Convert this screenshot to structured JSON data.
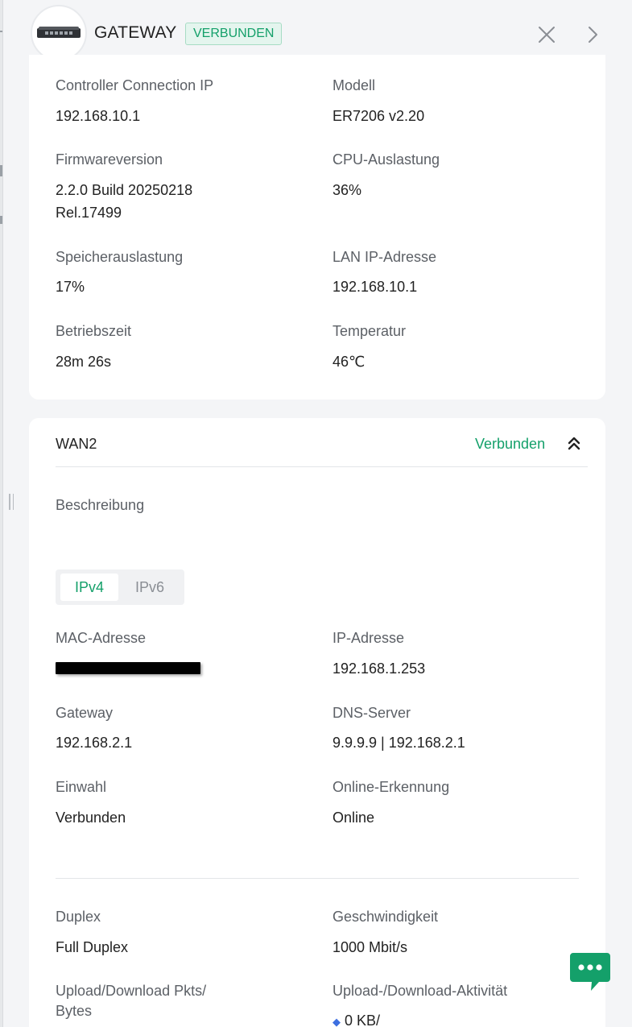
{
  "header": {
    "title": "GATEWAY",
    "status": "VERBUNDEN",
    "device_icon": "router-device-image",
    "close_icon": "close-icon",
    "next_icon": "chevron-right-icon"
  },
  "overview": {
    "fields": [
      {
        "label": "Controller Connection IP",
        "value": "192.168.10.1"
      },
      {
        "label": "Modell",
        "value": "ER7206 v2.20"
      },
      {
        "label": "Firmwareversion",
        "value": "2.2.0 Build 20250218",
        "value2": "Rel.17499"
      },
      {
        "label": "CPU-Auslastung",
        "value": "36%"
      },
      {
        "label": "Speicherauslastung",
        "value": "17%"
      },
      {
        "label": "LAN IP-Adresse",
        "value": "192.168.10.1"
      },
      {
        "label": "Betriebszeit",
        "value": "28m 26s"
      },
      {
        "label": "Temperatur",
        "value": "46℃"
      }
    ]
  },
  "wan": {
    "title": "WAN2",
    "status": "Verbunden",
    "description_label": "Beschreibung",
    "tabs": [
      {
        "label": "IPv4",
        "active": true
      },
      {
        "label": "IPv6",
        "active": false
      }
    ],
    "fields": [
      {
        "label": "MAC-Adresse",
        "value": ""
      },
      {
        "label": "IP-Adresse",
        "value": "192.168.1.253"
      },
      {
        "label": "Gateway",
        "value": "192.168.2.1"
      },
      {
        "label": "DNS-Server",
        "value": "9.9.9.9 | 192.168.2.1"
      },
      {
        "label": "Einwahl",
        "value": "Verbunden"
      },
      {
        "label": "Online-Erkennung",
        "value": "Online"
      },
      {
        "label": "Duplex",
        "value": "Full Duplex"
      },
      {
        "label": "Geschwindigkeit",
        "value": "1000 Mbit/s"
      },
      {
        "label": "Upload/Download Pkts/",
        "label2": "Bytes"
      },
      {
        "label": "Upload-/Download-Aktivität",
        "value": "0 KB/"
      }
    ]
  },
  "colors": {
    "accent": "#14a06a",
    "badge_bg": "#e4f5ee",
    "page_bg": "#f4f5f7"
  }
}
